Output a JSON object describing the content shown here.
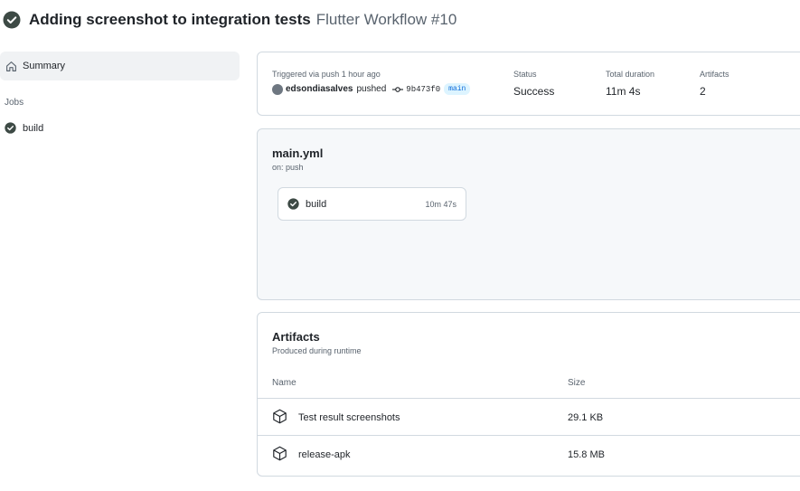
{
  "header": {
    "title": "Adding screenshot to integration tests",
    "subtitle": "Flutter Workflow #10",
    "status_icon": "check-circle-fill-icon"
  },
  "sidebar": {
    "summary_label": "Summary",
    "jobs_label": "Jobs",
    "jobs": [
      {
        "label": "build",
        "status_icon": "check-circle-fill-icon"
      }
    ]
  },
  "summary": {
    "trigger_label": "Triggered via push 1 hour ago",
    "actor": "edsondiasalves",
    "action": "pushed",
    "commit_sha": "9b473f0",
    "branch": "main",
    "status_label": "Status",
    "status_value": "Success",
    "duration_label": "Total duration",
    "duration_value": "11m 4s",
    "artifacts_label": "Artifacts",
    "artifacts_value": "2"
  },
  "workflow": {
    "file_name": "main.yml",
    "trigger": "on: push",
    "job": {
      "name": "build",
      "duration": "10m 47s"
    }
  },
  "artifacts": {
    "title": "Artifacts",
    "subtitle": "Produced during runtime",
    "columns": [
      "Name",
      "Size"
    ],
    "rows": [
      {
        "name": "Test result screenshots",
        "size": "29.1 KB",
        "icon": "package-icon"
      },
      {
        "name": "release-apk",
        "size": "15.8 MB",
        "icon": "package-icon"
      }
    ]
  },
  "colors": {
    "success": "#1f883d",
    "check_dark": "#3d4a45",
    "border": "#d1d9e0",
    "muted_text": "#59636e",
    "branch_bg": "#ddf4ff",
    "branch_text": "#0969da"
  }
}
